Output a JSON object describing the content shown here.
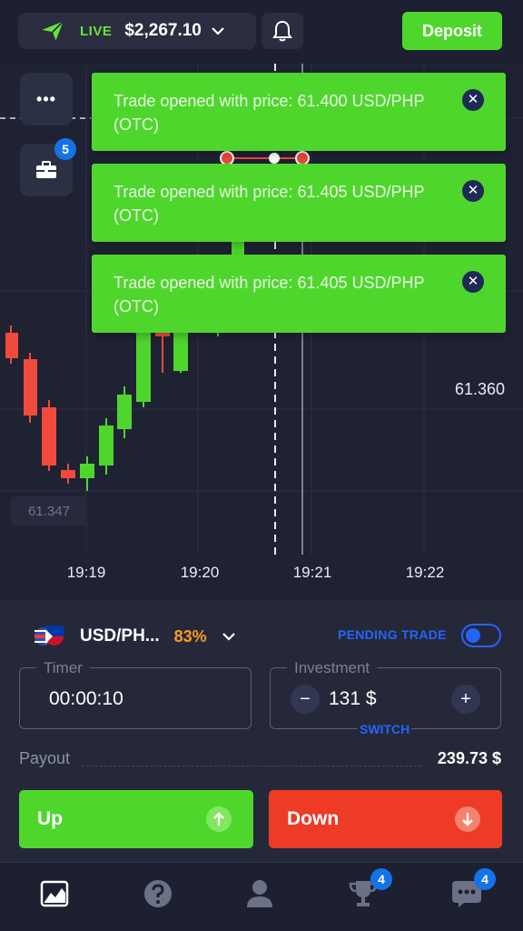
{
  "header": {
    "account_mode": "LIVE",
    "balance": "$2,267.10",
    "deposit_label": "Deposit"
  },
  "chart": {
    "menu_dots": "•••",
    "portfolio_badge": "5",
    "current_price": "61.360",
    "low_price": "61.347",
    "times": [
      "19:19",
      "19:20",
      "19:21",
      "19:22"
    ]
  },
  "toasts": [
    {
      "text": "Trade opened with price: 61.400 USD/PHP (OTC)",
      "close": "✕"
    },
    {
      "text": "Trade opened with price: 61.405 USD/PHP (OTC)",
      "close": "✕"
    },
    {
      "text": "Trade opened with price: 61.405 USD/PHP (OTC)",
      "close": "✕"
    }
  ],
  "trade": {
    "pair": "USD/PH...",
    "payout_pct": "83%",
    "pending_label": "PENDING TRADE",
    "pending_enabled": false,
    "timer_label": "Timer",
    "timer_value": "00:00:10",
    "investment_label": "Investment",
    "investment_value": "131 $",
    "minus": "−",
    "plus": "+",
    "switch_label": "SWITCH",
    "payout_label": "Payout",
    "payout_value": "239.73 $",
    "up_label": "Up",
    "down_label": "Down"
  },
  "nav": {
    "trophy_badge": "4",
    "chat_badge": "4"
  },
  "colors": {
    "accent_green": "#4fd62d",
    "accent_red": "#ee3b25",
    "accent_blue": "#2563ff",
    "payout_orange": "#ff9a1f"
  }
}
